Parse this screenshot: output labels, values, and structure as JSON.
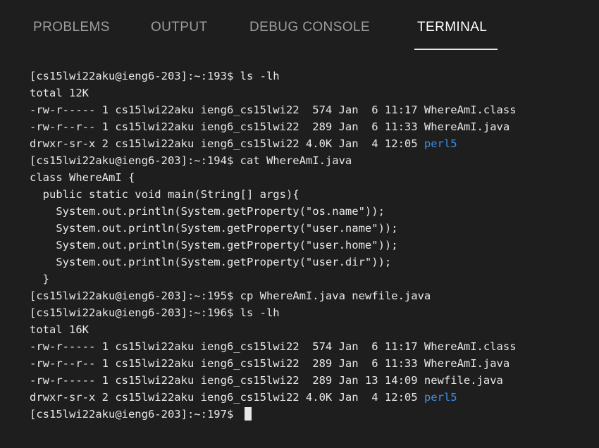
{
  "panel": {
    "tabs": [
      {
        "label": "PROBLEMS",
        "active": false
      },
      {
        "label": "OUTPUT",
        "active": false
      },
      {
        "label": "DEBUG CONSOLE",
        "active": false
      },
      {
        "label": "TERMINAL",
        "active": true
      }
    ]
  },
  "colors": {
    "background": "#1e1e1e",
    "active_tab": "#ffffff",
    "inactive_tab": "#9d9d9d",
    "terminal_text": "#e8e8e8",
    "directory": "#3b8eea"
  },
  "terminal": {
    "lines": [
      {
        "text": "[cs15lwi22aku@ieng6-203]:~:193$ ls -lh"
      },
      {
        "text": "total 12K"
      },
      {
        "text": "-rw-r----- 1 cs15lwi22aku ieng6_cs15lwi22  574 Jan  6 11:17 WhereAmI.class"
      },
      {
        "text": "-rw-r--r-- 1 cs15lwi22aku ieng6_cs15lwi22  289 Jan  6 11:33 WhereAmI.java"
      },
      {
        "text": "drwxr-sr-x 2 cs15lwi22aku ieng6_cs15lwi22 4.0K Jan  4 12:05 ",
        "dir": "perl5"
      },
      {
        "text": "[cs15lwi22aku@ieng6-203]:~:194$ cat WhereAmI.java"
      },
      {
        "text": "class WhereAmI {"
      },
      {
        "text": "  public static void main(String[] args){"
      },
      {
        "text": "    System.out.println(System.getProperty(\"os.name\"));"
      },
      {
        "text": "    System.out.println(System.getProperty(\"user.name\"));"
      },
      {
        "text": "    System.out.println(System.getProperty(\"user.home\"));"
      },
      {
        "text": "    System.out.println(System.getProperty(\"user.dir\"));"
      },
      {
        "text": "  }"
      },
      {
        "text": "[cs15lwi22aku@ieng6-203]:~:195$ cp WhereAmI.java newfile.java"
      },
      {
        "text": "[cs15lwi22aku@ieng6-203]:~:196$ ls -lh"
      },
      {
        "text": "total 16K"
      },
      {
        "text": "-rw-r----- 1 cs15lwi22aku ieng6_cs15lwi22  574 Jan  6 11:17 WhereAmI.class"
      },
      {
        "text": "-rw-r--r-- 1 cs15lwi22aku ieng6_cs15lwi22  289 Jan  6 11:33 WhereAmI.java"
      },
      {
        "text": "-rw-r----- 1 cs15lwi22aku ieng6_cs15lwi22  289 Jan 13 14:09 newfile.java"
      },
      {
        "text": "drwxr-sr-x 2 cs15lwi22aku ieng6_cs15lwi22 4.0K Jan  4 12:05 ",
        "dir": "perl5"
      },
      {
        "text": "[cs15lwi22aku@ieng6-203]:~:197$ ",
        "cursor": true
      }
    ]
  }
}
